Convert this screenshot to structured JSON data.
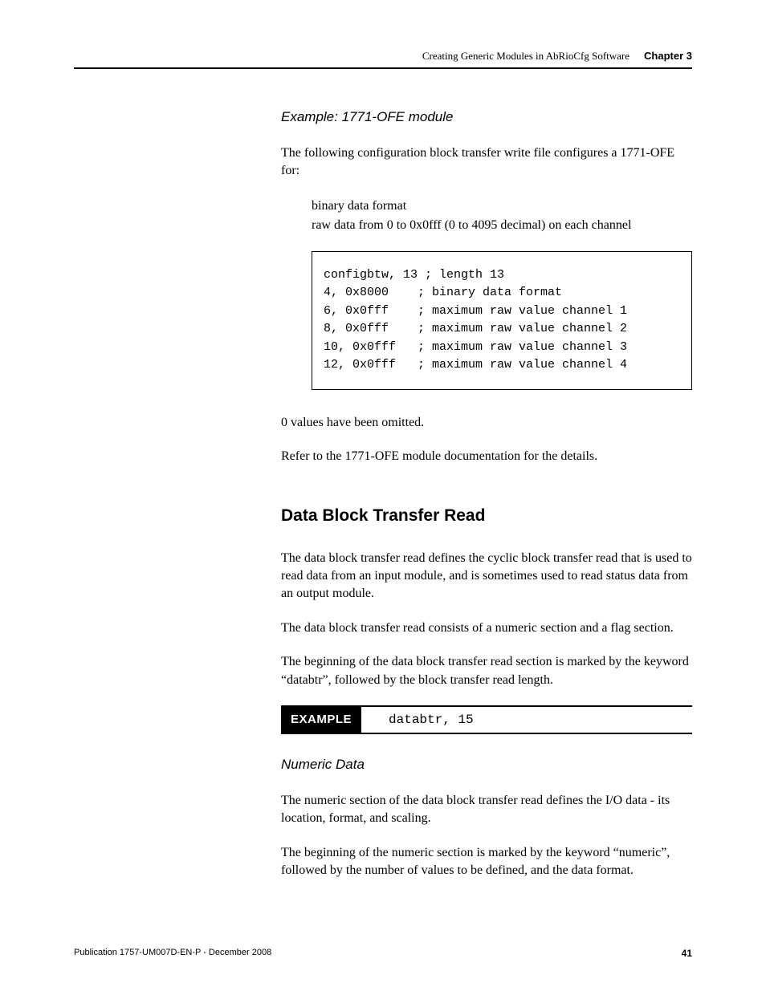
{
  "header": {
    "title": "Creating Generic Modules in AbRioCfg Software",
    "chapter": "Chapter 3"
  },
  "exampleHeading": "Example: 1771-OFE module",
  "intro": "The following configuration block transfer write file configures a 1771-OFE for:",
  "indents": {
    "line1": "binary data format",
    "line2": "raw data from 0 to 0x0fff (0 to 4095 decimal) on each channel"
  },
  "code": {
    "l1": "configbtw, 13 ; length 13",
    "l2": "4, 0x8000    ; binary data format",
    "l3": "6, 0x0fff    ; maximum raw value channel 1",
    "l4": "8, 0x0fff    ; maximum raw value channel 2",
    "l5": "10, 0x0fff   ; maximum raw value channel 3",
    "l6": "12, 0x0fff   ; maximum raw value channel 4"
  },
  "omitted": "0 values have been omitted.",
  "refer": "Refer to the 1771-OFE module documentation for the details.",
  "sectionHeading": "Data Block Transfer Read",
  "para1": "The data block transfer read defines the cyclic block transfer read that is used to read data from an input module, and is sometimes used to read status data from an output module.",
  "para2": "The data block transfer read consists of a numeric section and a flag section.",
  "para3": "The beginning of the data block transfer read section is marked by the keyword “databtr”, followed by the block transfer read length.",
  "exampleLabel": "EXAMPLE",
  "exampleCode": "databtr, 15",
  "subheading": "Numeric Data",
  "para4": "The numeric section of the data block transfer read defines the I/O data - its location, format, and scaling.",
  "para5": "The beginning of the numeric section is marked by the keyword “numeric”, followed by the number of values to be defined, and the data format.",
  "footer": {
    "publication": "Publication 1757-UM007D-EN-P - December 2008",
    "page": "41"
  }
}
